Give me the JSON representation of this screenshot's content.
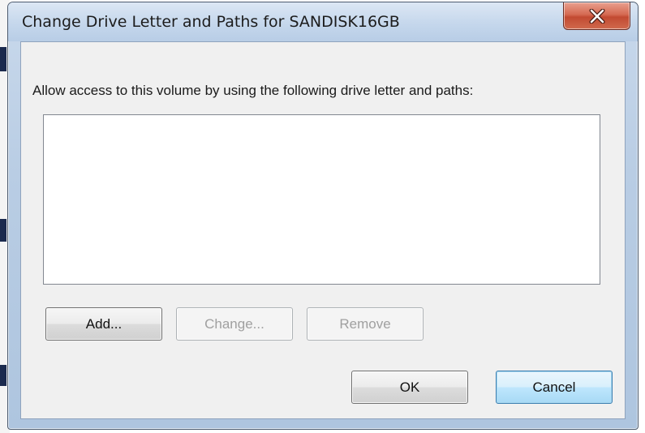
{
  "window": {
    "title": "Change Drive Letter and Paths for SANDISK16GB",
    "close_icon": "close-x-icon"
  },
  "dialog": {
    "prompt": "Allow access to this volume by using the following drive letter and paths:",
    "paths": []
  },
  "buttons": {
    "add": "Add...",
    "change": "Change...",
    "remove": "Remove",
    "ok": "OK",
    "cancel": "Cancel"
  },
  "colors": {
    "frame": "#b9cde4",
    "close_button": "#c24a31",
    "default_button_border": "#3c7fb1",
    "disabled_text": "#a0a0a0"
  }
}
